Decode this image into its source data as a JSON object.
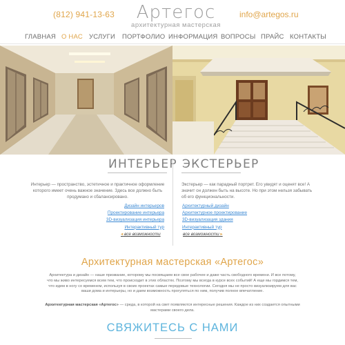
{
  "header": {
    "phone": "(812) 941-13-63",
    "email": "info@artegos.ru",
    "logo_title": "Артегос",
    "logo_subtitle": "архитектурная мастерская"
  },
  "nav": {
    "items": [
      {
        "label": "ГЛАВНАЯ",
        "active": false
      },
      {
        "label": "О НАС",
        "active": true
      },
      {
        "label": "УСЛУГИ",
        "active": false
      },
      {
        "label": "ПОРТФОЛИО",
        "active": false
      },
      {
        "label": "ИНФОРМАЦИЯ",
        "active": false
      },
      {
        "label": "ВОПРОСЫ",
        "active": false
      },
      {
        "label": "ПРАЙС",
        "active": false
      },
      {
        "label": "КОНТАКТЫ",
        "active": false
      }
    ]
  },
  "interior": {
    "heading": "ИНТЕРЬЕР",
    "text": "Интерьер — пространство, эстетичное и практичное оформление которого имеет очень важное значение. Здесь все должно быть продумано и сбалансировано.",
    "links": [
      "Дизайн интерьеров",
      "Проектирование интерьера",
      "3D-визуализация интерьера",
      "Интерактивный тур"
    ],
    "more": "все возможности"
  },
  "exterior": {
    "heading": "ЭКСТЕРЬЕР",
    "text": "Экстерьер — как парадный портрет. Его увидят и оценят все! А значит он должен быть на высоте. Но при этом нельзя забывать об его функциональности.",
    "links": [
      "Архитектурный дизайн",
      "Архитектурное проектирование",
      "3D-визуализация здания",
      "Интерактивный тур"
    ],
    "more": "все возможности"
  },
  "about": {
    "title": "Архитектурная мастерская «Артегос»",
    "text": "Архитектура и дизайн — наше призвание, которому мы посвящаем все свое рабочее и даже часть свободного времени. И все потому, что мы живо интересуемся всем тем, что происходит в этих областях. Поэтому мы всегда в курсе всех событий! А еще мы гордимся тем, что идем в ногу со временем, используя в своих проектах самые передовые технологии. Сегодня мы не просто визуализируем для вас ваши дома и интерьеры, но и даем возможность прогуляться по ним, получив полное впечатление.",
    "text2_bold": "Архитектурная мастерская «Артегос»",
    "text2": " — среда, в которой на свет появляются интересные решения. Каждое из них создается опытными мастерами своего дела."
  },
  "contact": {
    "title": "СВЯЖИТЕСЬ С НАМИ"
  },
  "colors": {
    "accent": "#e0a54a",
    "link": "#3a88d3",
    "contact": "#5db4dd"
  }
}
